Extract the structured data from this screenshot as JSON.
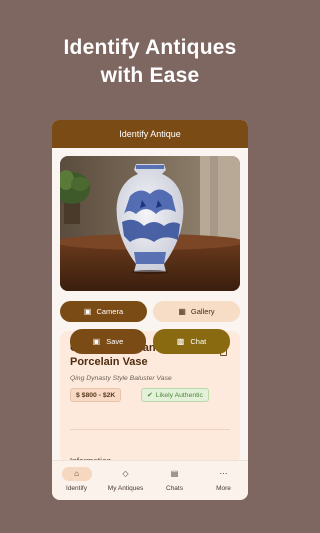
{
  "headline": {
    "line1": "Identify Antiques",
    "line2": "with Ease"
  },
  "appbar": {
    "title": "Identify Antique"
  },
  "buttons": {
    "camera": "Camera",
    "gallery": "Gallery"
  },
  "result": {
    "title": "Chinese Blue and White Porcelain Vase",
    "subtitle": "Qing Dynasty Style Baluster Vase",
    "price": "$ $800 - $2K",
    "authenticity": "Likely Authentic",
    "save": "Save",
    "chat": "Chat",
    "info_peek": "Information"
  },
  "tabs": [
    {
      "label": "Identify",
      "icon": "home-icon",
      "active": true
    },
    {
      "label": "My Antiques",
      "icon": "diamond-icon",
      "active": false
    },
    {
      "label": "Chats",
      "icon": "chat-icon",
      "active": false
    },
    {
      "label": "More",
      "icon": "more-dots-icon",
      "active": false
    }
  ],
  "colors": {
    "background": "#7e6760",
    "primary": "#7b4b15",
    "card": "#fdeadc",
    "chat_button": "#8a6a10",
    "authentic_green": "#4a8a3c"
  }
}
